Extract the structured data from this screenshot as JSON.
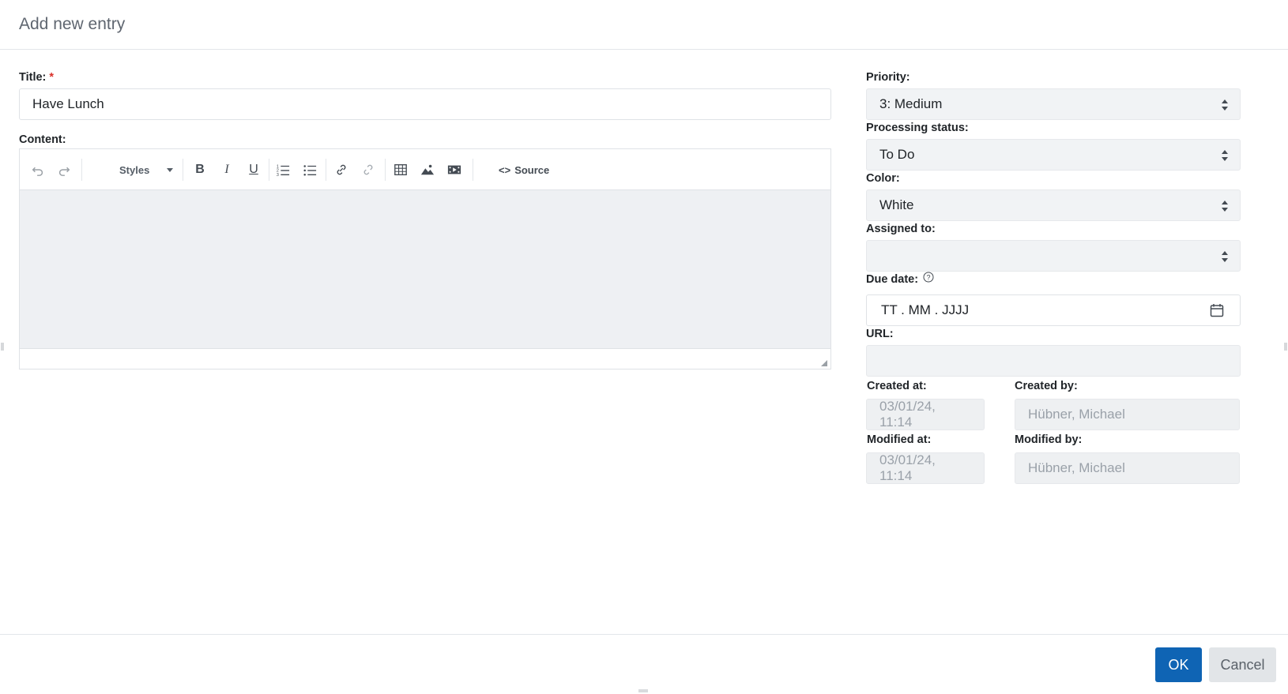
{
  "dialog": {
    "title": "Add new entry"
  },
  "form": {
    "title_label": "Title:",
    "title_required": "*",
    "title_value": "Have Lunch",
    "content_label": "Content:",
    "priority_label": "Priority:",
    "priority_value": "3: Medium",
    "status_label": "Processing status:",
    "status_value": "To Do",
    "color_label": "Color:",
    "color_value": "White",
    "assigned_label": "Assigned to:",
    "assigned_value": "",
    "due_label": "Due date:",
    "due_placeholder": "TT . MM . JJJJ",
    "url_label": "URL:",
    "url_value": "",
    "created_at_label": "Created at:",
    "created_at_value": "03/01/24, 11:14",
    "created_by_label": "Created by:",
    "created_by_value": "Hübner, Michael",
    "modified_at_label": "Modified at:",
    "modified_at_value": "03/01/24, 11:14",
    "modified_by_label": "Modified by:",
    "modified_by_value": "Hübner, Michael"
  },
  "editor": {
    "styles_label": "Styles",
    "source_label": "Source",
    "icons": [
      "undo-icon",
      "redo-icon",
      "bold-icon",
      "italic-icon",
      "underline-icon",
      "numbered-list-icon",
      "bulleted-list-icon",
      "link-icon",
      "unlink-icon",
      "table-icon",
      "image-icon",
      "media-icon",
      "source-code-icon"
    ]
  },
  "footer": {
    "ok_label": "OK",
    "cancel_label": "Cancel"
  },
  "colors": {
    "primary": "#0f64b4",
    "required": "#d9302a",
    "select_bg": "#f1f3f5"
  }
}
